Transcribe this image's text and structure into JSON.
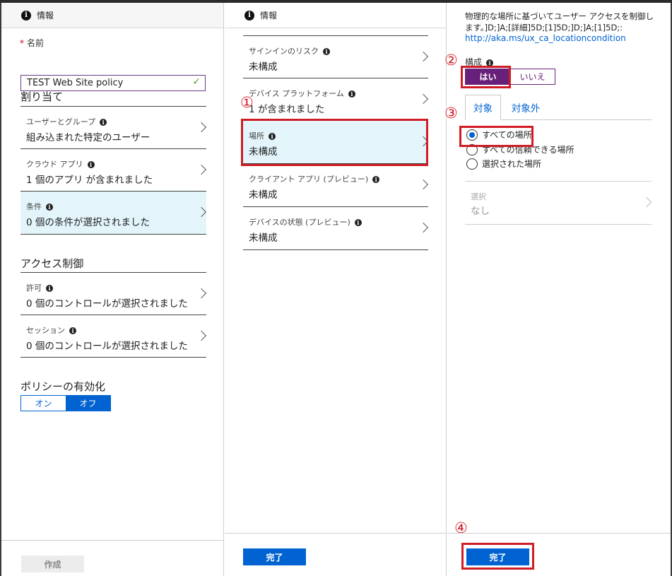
{
  "pane1": {
    "header": "情報",
    "name_label": "名前",
    "name_value": "TEST Web Site policy",
    "assign_title": "割り当て",
    "rows": [
      {
        "label": "ユーザーとグループ",
        "value": "組み込まれた特定のユーザー"
      },
      {
        "label": "クラウド アプリ",
        "value": "1 個のアプリ が含まれました"
      },
      {
        "label": "条件",
        "value": "0 個の条件が選択されました"
      }
    ],
    "access_title": "アクセス制御",
    "access_rows": [
      {
        "label": "許可",
        "value": "0 個のコントロールが選択されました"
      },
      {
        "label": "セッション",
        "value": "0 個のコントロールが選択されました"
      }
    ],
    "enable_title": "ポリシーの有効化",
    "toggle_on": "オン",
    "toggle_off": "オフ",
    "create_button": "作成"
  },
  "pane2": {
    "header": "情報",
    "rows": [
      {
        "label": "サインインのリスク",
        "value": "未構成"
      },
      {
        "label": "デバイス プラットフォーム",
        "value": "1 が含まれました"
      },
      {
        "label": "場所",
        "value": "未構成"
      },
      {
        "label": "クライアント アプリ (プレビュー)",
        "value": "未構成"
      },
      {
        "label": "デバイスの状態 (プレビュー)",
        "value": "未構成"
      }
    ],
    "done_button": "完了"
  },
  "pane3": {
    "description": "物理的な場所に基づいてユーザー アクセスを制御します。]D;]A;[詳細]5D;[1]5D;]D;]A;[1]5D;:",
    "link": "http://aka.ms/ux_ca_locationcondition",
    "configure_label": "構成",
    "yes": "はい",
    "no": "いいえ",
    "tab_include": "対象",
    "tab_exclude": "対象外",
    "radio_options": [
      "すべての場所",
      "すべての信頼できる場所",
      "選択された場所"
    ],
    "selected_option": "すべての場所",
    "select_label": "選択",
    "select_value": "なし",
    "done_button": "完了"
  },
  "markers": [
    "①",
    "②",
    "③",
    "④"
  ],
  "colors": {
    "accent_blue": "#0063d1",
    "purple": "#68217a",
    "highlight_bg": "#e3f5fb",
    "annotation_red": "#d01c25"
  }
}
